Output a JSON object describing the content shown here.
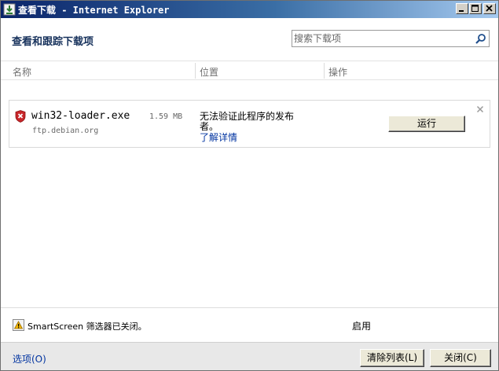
{
  "window": {
    "title": "查看下载 - Internet Explorer",
    "controls": [
      "minimize-icon",
      "maximize-icon",
      "close-icon"
    ]
  },
  "header": {
    "title": "查看和跟踪下载项",
    "search_placeholder": "搜索下载项"
  },
  "columns": {
    "name": "名称",
    "location": "位置",
    "actions": "操作"
  },
  "downloads": [
    {
      "file_name": "win32-loader.exe",
      "size": "1.59 MB",
      "source": "ftp.debian.org",
      "status_text": "无法验证此程序的发布者。",
      "details_link": "了解详情",
      "action_label": "运行",
      "icon": "shield-warning-icon"
    }
  ],
  "smartscreen": {
    "status_text": "SmartScreen 筛选器已关闭。",
    "enable_link": "启用"
  },
  "footer": {
    "options_link": "选项(O)",
    "clear_list_label": "清除列表(L)",
    "close_label": "关闭(C)"
  },
  "colors": {
    "title_gradient_start": "#0a246a",
    "title_gradient_end": "#a6caf0",
    "heading_text": "#17325c",
    "link": "#0033a0",
    "warning_shield": "#c8262a"
  }
}
